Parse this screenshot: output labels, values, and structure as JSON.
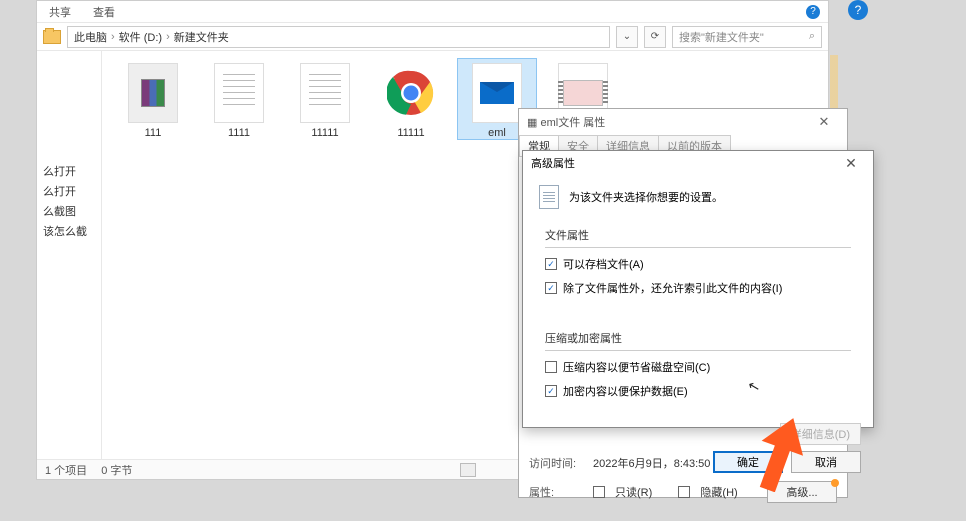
{
  "menubar": {
    "share": "共享",
    "view": "查看"
  },
  "breadcrumb": {
    "pc": "此电脑",
    "drive": "软件 (D:)",
    "folder": "新建文件夹"
  },
  "addr": {
    "refresh_glyph": "⟳",
    "dropdown_glyph": "⌄"
  },
  "search": {
    "placeholder": "搜索\"新建文件夹\"",
    "icon_glyph": "⌕"
  },
  "sidebar": {
    "items": [
      "么打开",
      "么打开",
      "么截图",
      "该怎么截"
    ]
  },
  "files": [
    {
      "name": "111",
      "type": "rar"
    },
    {
      "name": "1111",
      "type": "paper"
    },
    {
      "name": "11111",
      "type": "paper"
    },
    {
      "name": "11111",
      "type": "chrome"
    },
    {
      "name": "eml",
      "type": "mail",
      "selected": true
    },
    {
      "name": "",
      "type": "video"
    },
    {
      "name": "",
      "type": "empty"
    }
  ],
  "status": {
    "count": "1 个项目",
    "size": "0 字节"
  },
  "properties_dialog": {
    "title": "eml文件 属性",
    "tabs": [
      "常规",
      "安全",
      "详细信息",
      "以前的版本"
    ],
    "access_label": "访问时间:",
    "access_value": "2022年6月9日，8:43:50",
    "attr_label": "属性:",
    "readonly": "只读(R)",
    "hidden": "隐藏(H)",
    "advanced_btn": "高级..."
  },
  "advanced_dialog": {
    "title": "高级属性",
    "heading": "为该文件夹选择你想要的设置。",
    "group1_title": "文件属性",
    "opt_archive": "可以存档文件(A)",
    "opt_index": "除了文件属性外，还允许索引此文件的内容(I)",
    "group2_title": "压缩或加密属性",
    "opt_compress": "压缩内容以便节省磁盘空间(C)",
    "opt_encrypt": "加密内容以便保护数据(E)",
    "detail_btn": "详细信息(D)",
    "ok": "确定",
    "cancel": "取消"
  },
  "icons": {
    "close": "✕",
    "check": "✓",
    "help": "?",
    "prop_icon": "▦",
    "cursor": "↖"
  },
  "checks": {
    "archive": true,
    "index": true,
    "compress": false,
    "encrypt": true,
    "readonly": false,
    "hidden": false
  }
}
